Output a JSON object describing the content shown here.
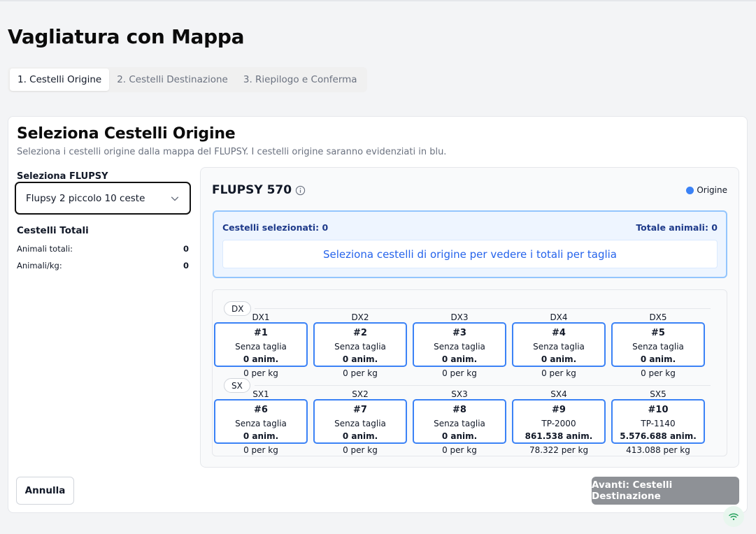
{
  "page": {
    "title": "Vagliatura con Mappa"
  },
  "tabs": [
    {
      "label": "1. Cestelli Origine",
      "active": true
    },
    {
      "label": "2. Cestelli Destinazione",
      "active": false
    },
    {
      "label": "3. Riepilogo e Conferma",
      "active": false
    }
  ],
  "card": {
    "title": "Seleziona Cestelli Origine",
    "description": "Seleziona i cestelli origine dalla mappa del FLUPSY. I cestelli origine saranno evidenziati in blu."
  },
  "flupsy_select": {
    "label": "Seleziona FLUPSY",
    "value": "Flupsy 2 piccolo 10 ceste"
  },
  "totals": {
    "title": "Cestelli Totali",
    "rows": [
      {
        "label": "Animali totali:",
        "value": "0"
      },
      {
        "label": "Animali/kg:",
        "value": "0"
      }
    ]
  },
  "map": {
    "title": "FLUPSY 570",
    "legend_label": "Origine",
    "accent_color": "#3b82f6",
    "selected_label": "Cestelli selezionati: 0",
    "total_label": "Totale animali: 0",
    "hint": "Seleziona cestelli di origine per vedere i totali per taglia",
    "rows": [
      {
        "tag": "DX",
        "baskets": [
          {
            "pos": "DX1",
            "num": "#1",
            "size": "Senza taglia",
            "anim": "0 anim.",
            "perkg": "0 per kg"
          },
          {
            "pos": "DX2",
            "num": "#2",
            "size": "Senza taglia",
            "anim": "0 anim.",
            "perkg": "0 per kg"
          },
          {
            "pos": "DX3",
            "num": "#3",
            "size": "Senza taglia",
            "anim": "0 anim.",
            "perkg": "0 per kg"
          },
          {
            "pos": "DX4",
            "num": "#4",
            "size": "Senza taglia",
            "anim": "0 anim.",
            "perkg": "0 per kg"
          },
          {
            "pos": "DX5",
            "num": "#5",
            "size": "Senza taglia",
            "anim": "0 anim.",
            "perkg": "0 per kg"
          }
        ]
      },
      {
        "tag": "SX",
        "baskets": [
          {
            "pos": "SX1",
            "num": "#6",
            "size": "Senza taglia",
            "anim": "0 anim.",
            "perkg": "0 per kg"
          },
          {
            "pos": "SX2",
            "num": "#7",
            "size": "Senza taglia",
            "anim": "0 anim.",
            "perkg": "0 per kg"
          },
          {
            "pos": "SX3",
            "num": "#8",
            "size": "Senza taglia",
            "anim": "0 anim.",
            "perkg": "0 per kg"
          },
          {
            "pos": "SX4",
            "num": "#9",
            "size": "TP-2000",
            "anim": "861.538 anim.",
            "perkg": "78.322 per kg"
          },
          {
            "pos": "SX5",
            "num": "#10",
            "size": "TP-1140",
            "anim": "5.576.688 anim.",
            "perkg": "413.088 per kg"
          }
        ]
      }
    ]
  },
  "actions": {
    "cancel_label": "Annulla",
    "next_label": "Avanti: Cestelli Destinazione"
  },
  "icons": {
    "select_chevron": "chevron-down-icon",
    "info": "info-icon",
    "status": "wifi-icon"
  }
}
